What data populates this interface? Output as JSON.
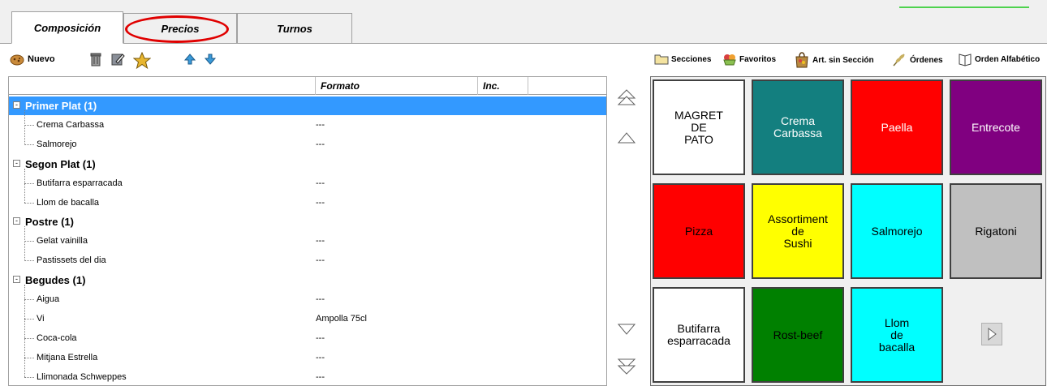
{
  "tabs": [
    {
      "label": "Composición",
      "active": true
    },
    {
      "label": "Precios",
      "active": false
    },
    {
      "label": "Turnos",
      "active": false
    }
  ],
  "toolbar": {
    "new_label": "Nuevo",
    "icons": [
      "cookie-icon",
      "trash-icon",
      "edit-icon",
      "star-icon",
      "arrow-up-icon",
      "arrow-down-icon"
    ]
  },
  "right_toolbar": {
    "sections_label": "Secciones",
    "favorites_label": "Favoritos",
    "no_section_label": "Art. sin Sección",
    "orders_label": "Órdenes",
    "alpha_label": "Orden Alfabético"
  },
  "tree": {
    "columns": [
      "",
      "Formato",
      "Inc.",
      ""
    ],
    "groups": [
      {
        "name": "Primer Plat (1)",
        "selected": true,
        "items": [
          {
            "name": "Crema Carbassa",
            "format": "---"
          },
          {
            "name": "Salmorejo",
            "format": "---"
          }
        ]
      },
      {
        "name": "Segon Plat (1)",
        "selected": false,
        "items": [
          {
            "name": "Butifarra esparracada",
            "format": "---"
          },
          {
            "name": "Llom de bacalla",
            "format": "---"
          }
        ]
      },
      {
        "name": "Postre (1)",
        "selected": false,
        "items": [
          {
            "name": "Gelat vainilla",
            "format": "---"
          },
          {
            "name": "Pastissets del dia",
            "format": "---"
          }
        ]
      },
      {
        "name": "Begudes (1)",
        "selected": false,
        "items": [
          {
            "name": "Aigua",
            "format": "---"
          },
          {
            "name": "Vi",
            "format": "Ampolla 75cl"
          },
          {
            "name": "Coca-cola",
            "format": "---"
          },
          {
            "name": "Mitjana Estrella",
            "format": "---"
          },
          {
            "name": "Llimonada Schweppes",
            "format": "---"
          }
        ]
      }
    ]
  },
  "products": [
    {
      "label": "MAGRET\nDE\nPATO",
      "bg": "#ffffff",
      "fg": "#000000"
    },
    {
      "label": "Crema\nCarbassa",
      "bg": "#137f7f",
      "fg": "#ffffff"
    },
    {
      "label": "Paella",
      "bg": "#ff0000",
      "fg": "#ffffff"
    },
    {
      "label": "Entrecote",
      "bg": "#800080",
      "fg": "#ffffff"
    },
    {
      "label": "Pizza",
      "bg": "#ff0000",
      "fg": "#000000"
    },
    {
      "label": "Assortiment\nde\nSushi",
      "bg": "#ffff00",
      "fg": "#000000"
    },
    {
      "label": "Salmorejo",
      "bg": "#00ffff",
      "fg": "#000000"
    },
    {
      "label": "Rigatoni",
      "bg": "#c0c0c0",
      "fg": "#000000"
    },
    {
      "label": "Butifarra\nesparracada",
      "bg": "#ffffff",
      "fg": "#000000"
    },
    {
      "label": "Rost-beef",
      "bg": "#008000",
      "fg": "#000000"
    },
    {
      "label": "Llom\nde\nbacalla",
      "bg": "#00ffff",
      "fg": "#000000"
    }
  ],
  "colors": {
    "selection": "#3399ff",
    "highlight_ellipse": "#e00000"
  }
}
